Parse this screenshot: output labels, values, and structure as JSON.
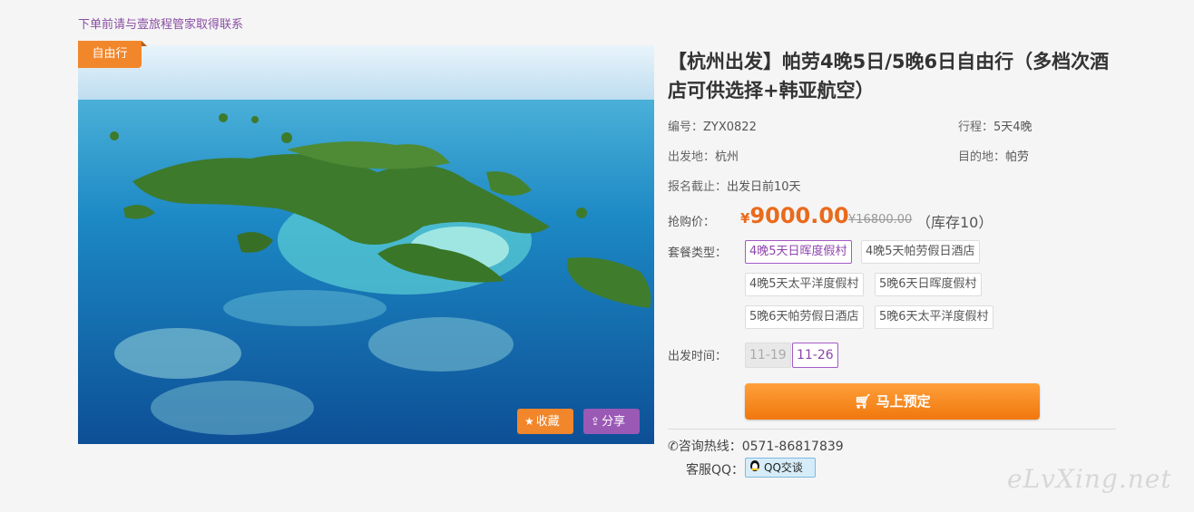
{
  "notice": "下单前请与壹旅程管家取得联系",
  "photo": {
    "tag": "自由行",
    "favorite_label": "收藏",
    "share_label": "分享",
    "favorite_icon": "star-icon",
    "share_icon": "share-icon"
  },
  "product": {
    "title": "【杭州出发】帕劳4晚5日/5晚6日自由行（多档次酒店可供选择+韩亚航空）",
    "code_label": "编号：",
    "code": "ZYX0822",
    "itinerary_label": "行程：",
    "itinerary": "5天4晚",
    "departure_label": "出发地：",
    "departure": "杭州",
    "destination_label": "目的地：",
    "destination": "帕劳",
    "deadline_label": "报名截止：",
    "deadline": "出发日前10天"
  },
  "pricing": {
    "label": "抢购价：",
    "currency": "¥",
    "price": "9000.00",
    "original": "¥16800.00",
    "stock": "（库存10）",
    "accent_color": "#ea6a1c"
  },
  "packages": {
    "label": "套餐类型：",
    "options": [
      {
        "label": "4晚5天日晖度假村",
        "selected": true
      },
      {
        "label": "4晚5天帕劳假日酒店",
        "selected": false
      },
      {
        "label": "4晚5天太平洋度假村",
        "selected": false
      },
      {
        "label": "5晚6天日晖度假村",
        "selected": false
      },
      {
        "label": "5晚6天帕劳假日酒店",
        "selected": false
      },
      {
        "label": "5晚6天太平洋度假村",
        "selected": false
      }
    ]
  },
  "dates": {
    "label": "出发时间：",
    "options": [
      {
        "label": "11-19",
        "state": "disabled"
      },
      {
        "label": "11-26",
        "state": "selected"
      }
    ]
  },
  "book_button": {
    "label": "马上预定",
    "icon": "cart-icon"
  },
  "contact": {
    "hotline_label": "咨询热线：",
    "hotline": "0571-86817839",
    "qq_label": "客服QQ：",
    "qq_button": "QQ交谈",
    "phone_icon": "phone-icon",
    "qq_icon": "qq-penguin-icon"
  },
  "watermark": "eLvXing.net"
}
